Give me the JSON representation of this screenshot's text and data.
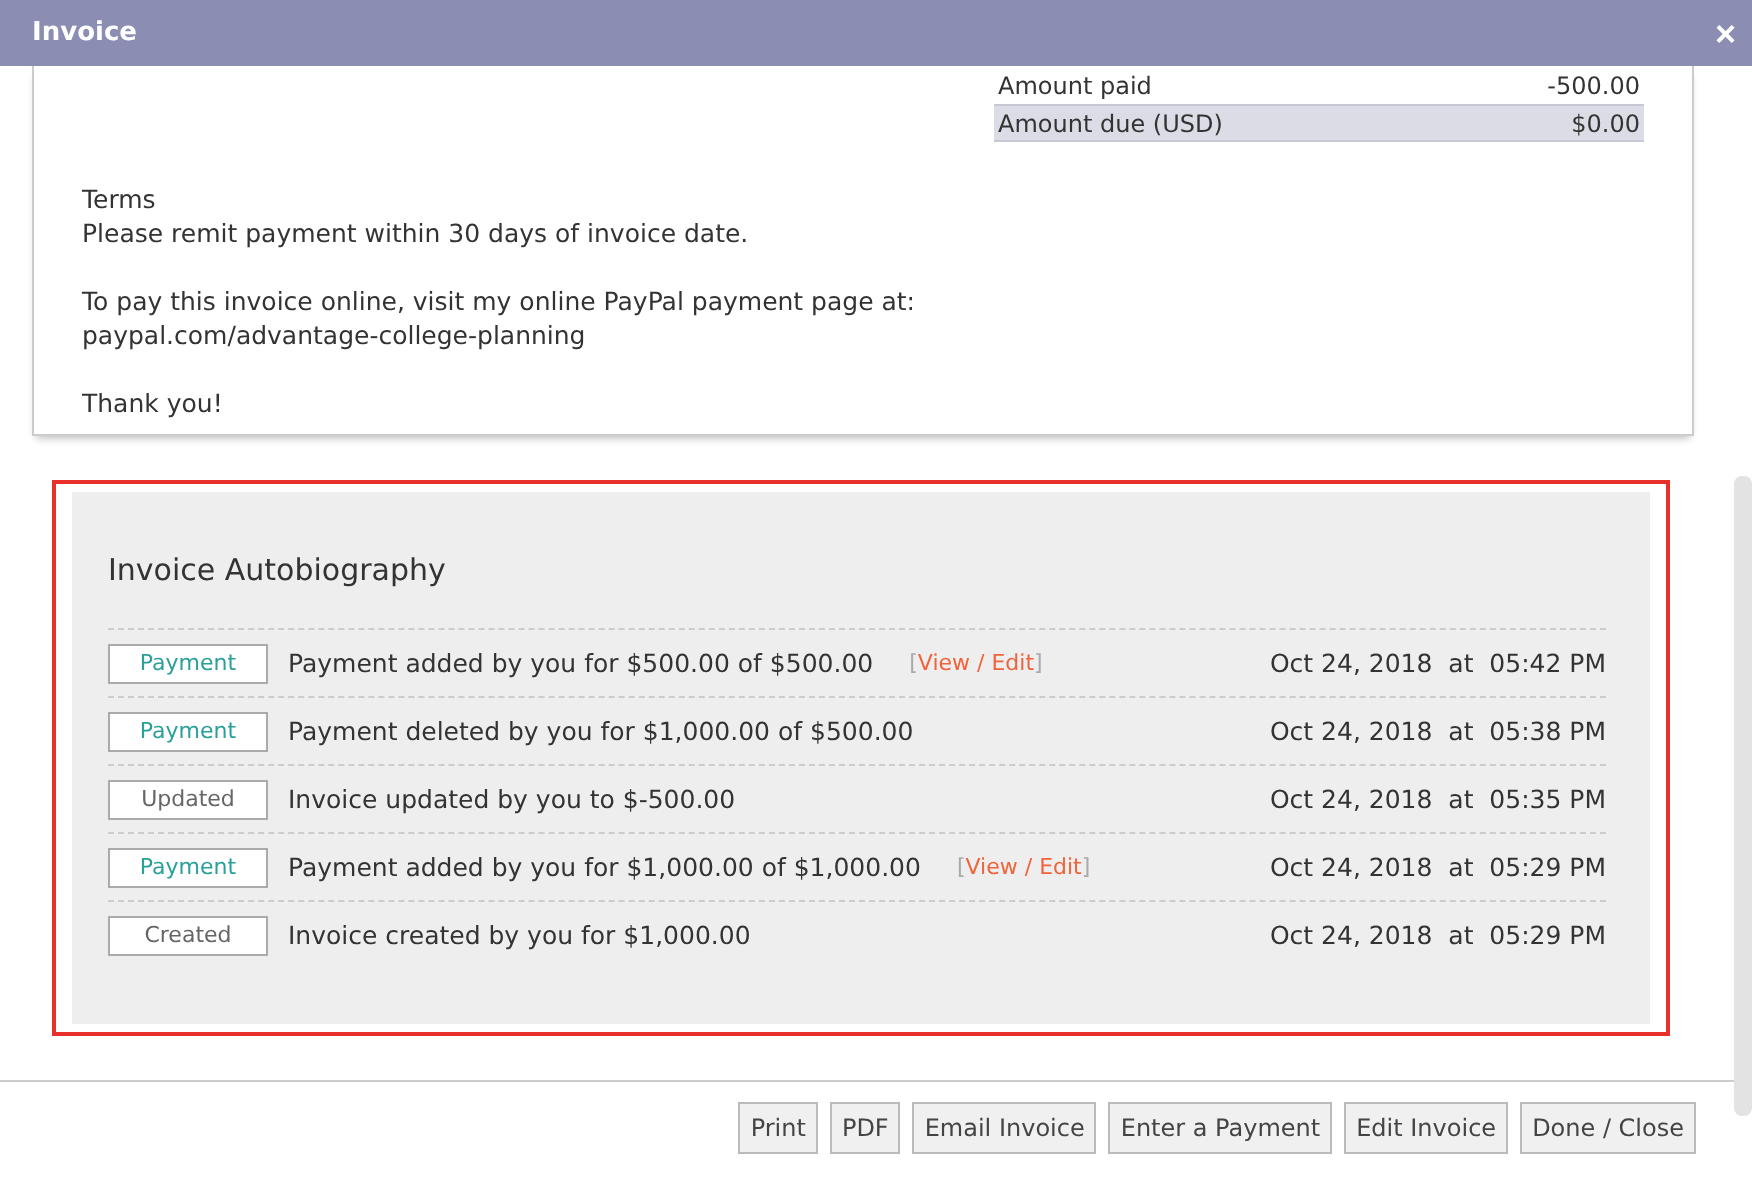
{
  "window": {
    "title": "Invoice",
    "close": "×"
  },
  "totals": [
    {
      "label": "Amount paid",
      "value": "-500.00",
      "highlighted": false
    },
    {
      "label": "Amount due (USD)",
      "value": "$0.00",
      "highlighted": true
    }
  ],
  "notes": [
    [
      "Terms",
      "Please remit payment within 30 days of invoice date."
    ],
    [
      "To pay this invoice online, visit my online PayPal payment page at:",
      "paypal.com/advantage-college-planning"
    ],
    [
      "Thank you!"
    ]
  ],
  "history": {
    "title": "Invoice Autobiography",
    "rows": [
      {
        "tag": "Payment",
        "kind": "payment",
        "text": "Payment added by you for $500.00 of $500.00",
        "link": {
          "open": "[",
          "label": "View / Edit",
          "close": "]"
        },
        "date": "Oct 24, 2018",
        "at": "at",
        "time": "05:42 PM"
      },
      {
        "tag": "Payment",
        "kind": "payment",
        "text": "Payment deleted by you for $1,000.00 of $500.00",
        "date": "Oct 24, 2018",
        "at": "at",
        "time": "05:38 PM"
      },
      {
        "tag": "Updated",
        "kind": "plain",
        "text": "Invoice updated by you to $-500.00",
        "date": "Oct 24, 2018",
        "at": "at",
        "time": "05:35 PM"
      },
      {
        "tag": "Payment",
        "kind": "payment",
        "text": "Payment added by you for $1,000.00 of $1,000.00",
        "link": {
          "open": "[",
          "label": "View / Edit",
          "close": "]"
        },
        "date": "Oct 24, 2018",
        "at": "at",
        "time": "05:29 PM"
      },
      {
        "tag": "Created",
        "kind": "plain",
        "text": "Invoice created by you for $1,000.00",
        "date": "Oct 24, 2018",
        "at": "at",
        "time": "05:29 PM"
      }
    ]
  },
  "buttons": [
    "Print",
    "PDF",
    "Email Invoice",
    "Enter a Payment",
    "Edit Invoice",
    "Done / Close"
  ]
}
